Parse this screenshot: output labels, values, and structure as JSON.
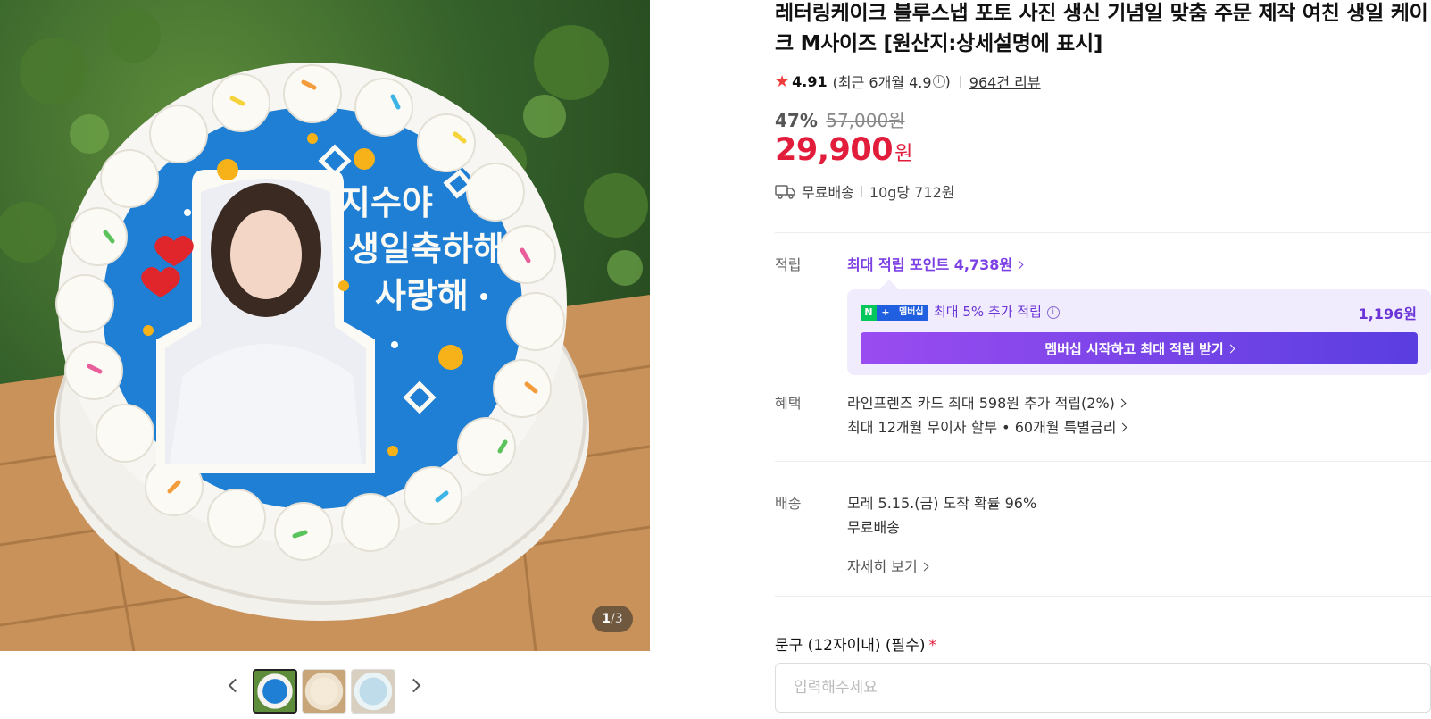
{
  "product": {
    "title": "레터링케이크 블루스냅 포토 사진 생신 기념일 맞춤 주문 제작 여친 생일 케이크 M사이즈 [원산지:상세설명에 표시]",
    "rating_score": "4.91",
    "rating_recent": "(최근 6개월 4.9",
    "rating_recent_info": "i",
    "rating_recent_close": ")",
    "review_count": "964건 리뷰",
    "discount_rate": "47%",
    "original_price": "57,000원",
    "price": "29,900",
    "price_unit": "원",
    "shipping": "무료배송",
    "unit_price": "10g당 712원"
  },
  "gallery": {
    "counter_current": "1",
    "counter_sep": "/",
    "counter_total": "3",
    "cake_text_line1": "지수야",
    "cake_text_line2": "생일축하해",
    "cake_text_line3": "사랑해"
  },
  "points": {
    "label": "적립",
    "link": "최대 적립 포인트 4,738원",
    "membership_badge_n": "N",
    "membership_badge_plus": "+",
    "membership_badge_text": "멤버십",
    "membership_text": "최대 5% 추가 적립",
    "membership_info": "i",
    "membership_amount": "1,196원",
    "membership_button": "멤버십 시작하고 최대 적립 받기"
  },
  "benefits": {
    "label": "혜택",
    "card": "라인프렌즈 카드 최대 598원 추가 적립(2%)",
    "installment": "최대 12개월 무이자 할부 • 60개월 특별금리"
  },
  "delivery": {
    "label": "배송",
    "arrival": "모레 5.15.(금) 도착 확률 96%",
    "fee": "무료배송",
    "detail_link": "자세히 보기"
  },
  "option": {
    "label": "문구 (12자이내) (필수)",
    "required_mark": "*",
    "placeholder": "입력해주세요"
  },
  "colors": {
    "price_red": "#e21d3c",
    "point_purple": "#7b3fe4",
    "membership_bg": "#f1ecfd",
    "cake_blue": "#1e7fd4"
  }
}
